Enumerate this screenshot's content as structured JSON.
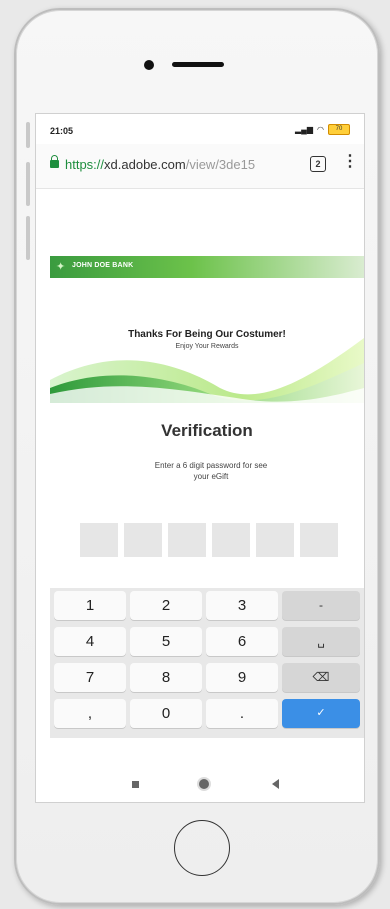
{
  "status": {
    "time": "21:05",
    "battery": "70"
  },
  "browser": {
    "url_scheme": "https://",
    "url_host": "xd.adobe.com",
    "url_path": "/view/3de15",
    "tab_count": "2",
    "menu_label": "⋮"
  },
  "bank": {
    "name": "JOHN DOE BANK"
  },
  "banner": {
    "title": "Thanks For Being Our Costumer!",
    "subtitle": "Enjoy Your Rewards"
  },
  "verification": {
    "title": "Verification",
    "instructions": "Enter a 6 digit password for see your eGift",
    "pin_length": 6
  },
  "keypad": {
    "keys": [
      "1",
      "2",
      "3",
      "4",
      "5",
      "6",
      "7",
      "8",
      "9",
      ",",
      "0",
      "."
    ],
    "actions": [
      "-",
      "␣",
      "⌫",
      "✓"
    ]
  },
  "colors": {
    "accent": "#3b8fe6",
    "brand_green": "#3a9b3f"
  }
}
